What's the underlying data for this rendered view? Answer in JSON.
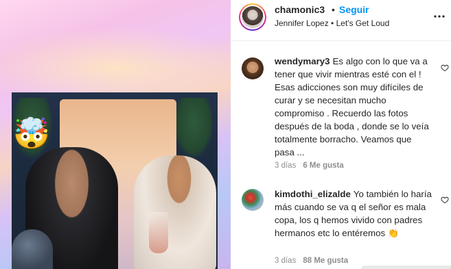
{
  "post": {
    "username": "chamonic3",
    "separator": "•",
    "follow_label": "Seguir",
    "audio": "Jennifer Lopez • Let's Get Loud",
    "more_icon": "more-horizontal-icon"
  },
  "media": {
    "overlay_emoji": "🤯"
  },
  "comments": [
    {
      "username": "wendymary3",
      "text": "Es algo con lo que va a tener que vivir mientras esté con el ! Esas adicciones son muy difíciles de curar y se necesitan mucho compromiso . Recuerdo las fotos después de la boda , donde se lo veía totalmente borracho. Veamos que pasa ...",
      "time": "3 días",
      "likes": "6 Me gusta"
    },
    {
      "username": "kimdothi_elizalde",
      "text": "Yo también lo haría más cuando se va q el señor es mala copa, los q hemos vivido con padres hermanos etc lo entéremos 👏",
      "time": "3 días",
      "likes": "88 Me gusta"
    }
  ],
  "colors": {
    "follow": "#0095f6",
    "meta": "#8e8e8e",
    "text": "#262626"
  }
}
